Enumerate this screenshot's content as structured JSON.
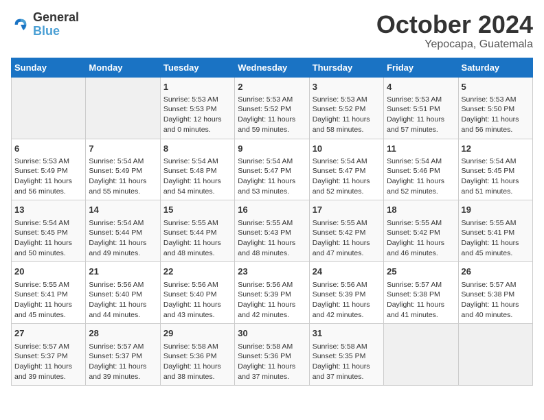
{
  "header": {
    "logo_line1": "General",
    "logo_line2": "Blue",
    "month": "October 2024",
    "location": "Yepocapa, Guatemala"
  },
  "weekdays": [
    "Sunday",
    "Monday",
    "Tuesday",
    "Wednesday",
    "Thursday",
    "Friday",
    "Saturday"
  ],
  "weeks": [
    [
      {
        "day": "",
        "info": ""
      },
      {
        "day": "",
        "info": ""
      },
      {
        "day": "1",
        "info": "Sunrise: 5:53 AM\nSunset: 5:53 PM\nDaylight: 12 hours and 0 minutes."
      },
      {
        "day": "2",
        "info": "Sunrise: 5:53 AM\nSunset: 5:52 PM\nDaylight: 11 hours and 59 minutes."
      },
      {
        "day": "3",
        "info": "Sunrise: 5:53 AM\nSunset: 5:52 PM\nDaylight: 11 hours and 58 minutes."
      },
      {
        "day": "4",
        "info": "Sunrise: 5:53 AM\nSunset: 5:51 PM\nDaylight: 11 hours and 57 minutes."
      },
      {
        "day": "5",
        "info": "Sunrise: 5:53 AM\nSunset: 5:50 PM\nDaylight: 11 hours and 56 minutes."
      }
    ],
    [
      {
        "day": "6",
        "info": "Sunrise: 5:53 AM\nSunset: 5:49 PM\nDaylight: 11 hours and 56 minutes."
      },
      {
        "day": "7",
        "info": "Sunrise: 5:54 AM\nSunset: 5:49 PM\nDaylight: 11 hours and 55 minutes."
      },
      {
        "day": "8",
        "info": "Sunrise: 5:54 AM\nSunset: 5:48 PM\nDaylight: 11 hours and 54 minutes."
      },
      {
        "day": "9",
        "info": "Sunrise: 5:54 AM\nSunset: 5:47 PM\nDaylight: 11 hours and 53 minutes."
      },
      {
        "day": "10",
        "info": "Sunrise: 5:54 AM\nSunset: 5:47 PM\nDaylight: 11 hours and 52 minutes."
      },
      {
        "day": "11",
        "info": "Sunrise: 5:54 AM\nSunset: 5:46 PM\nDaylight: 11 hours and 52 minutes."
      },
      {
        "day": "12",
        "info": "Sunrise: 5:54 AM\nSunset: 5:45 PM\nDaylight: 11 hours and 51 minutes."
      }
    ],
    [
      {
        "day": "13",
        "info": "Sunrise: 5:54 AM\nSunset: 5:45 PM\nDaylight: 11 hours and 50 minutes."
      },
      {
        "day": "14",
        "info": "Sunrise: 5:54 AM\nSunset: 5:44 PM\nDaylight: 11 hours and 49 minutes."
      },
      {
        "day": "15",
        "info": "Sunrise: 5:55 AM\nSunset: 5:44 PM\nDaylight: 11 hours and 48 minutes."
      },
      {
        "day": "16",
        "info": "Sunrise: 5:55 AM\nSunset: 5:43 PM\nDaylight: 11 hours and 48 minutes."
      },
      {
        "day": "17",
        "info": "Sunrise: 5:55 AM\nSunset: 5:42 PM\nDaylight: 11 hours and 47 minutes."
      },
      {
        "day": "18",
        "info": "Sunrise: 5:55 AM\nSunset: 5:42 PM\nDaylight: 11 hours and 46 minutes."
      },
      {
        "day": "19",
        "info": "Sunrise: 5:55 AM\nSunset: 5:41 PM\nDaylight: 11 hours and 45 minutes."
      }
    ],
    [
      {
        "day": "20",
        "info": "Sunrise: 5:55 AM\nSunset: 5:41 PM\nDaylight: 11 hours and 45 minutes."
      },
      {
        "day": "21",
        "info": "Sunrise: 5:56 AM\nSunset: 5:40 PM\nDaylight: 11 hours and 44 minutes."
      },
      {
        "day": "22",
        "info": "Sunrise: 5:56 AM\nSunset: 5:40 PM\nDaylight: 11 hours and 43 minutes."
      },
      {
        "day": "23",
        "info": "Sunrise: 5:56 AM\nSunset: 5:39 PM\nDaylight: 11 hours and 42 minutes."
      },
      {
        "day": "24",
        "info": "Sunrise: 5:56 AM\nSunset: 5:39 PM\nDaylight: 11 hours and 42 minutes."
      },
      {
        "day": "25",
        "info": "Sunrise: 5:57 AM\nSunset: 5:38 PM\nDaylight: 11 hours and 41 minutes."
      },
      {
        "day": "26",
        "info": "Sunrise: 5:57 AM\nSunset: 5:38 PM\nDaylight: 11 hours and 40 minutes."
      }
    ],
    [
      {
        "day": "27",
        "info": "Sunrise: 5:57 AM\nSunset: 5:37 PM\nDaylight: 11 hours and 39 minutes."
      },
      {
        "day": "28",
        "info": "Sunrise: 5:57 AM\nSunset: 5:37 PM\nDaylight: 11 hours and 39 minutes."
      },
      {
        "day": "29",
        "info": "Sunrise: 5:58 AM\nSunset: 5:36 PM\nDaylight: 11 hours and 38 minutes."
      },
      {
        "day": "30",
        "info": "Sunrise: 5:58 AM\nSunset: 5:36 PM\nDaylight: 11 hours and 37 minutes."
      },
      {
        "day": "31",
        "info": "Sunrise: 5:58 AM\nSunset: 5:35 PM\nDaylight: 11 hours and 37 minutes."
      },
      {
        "day": "",
        "info": ""
      },
      {
        "day": "",
        "info": ""
      }
    ]
  ]
}
